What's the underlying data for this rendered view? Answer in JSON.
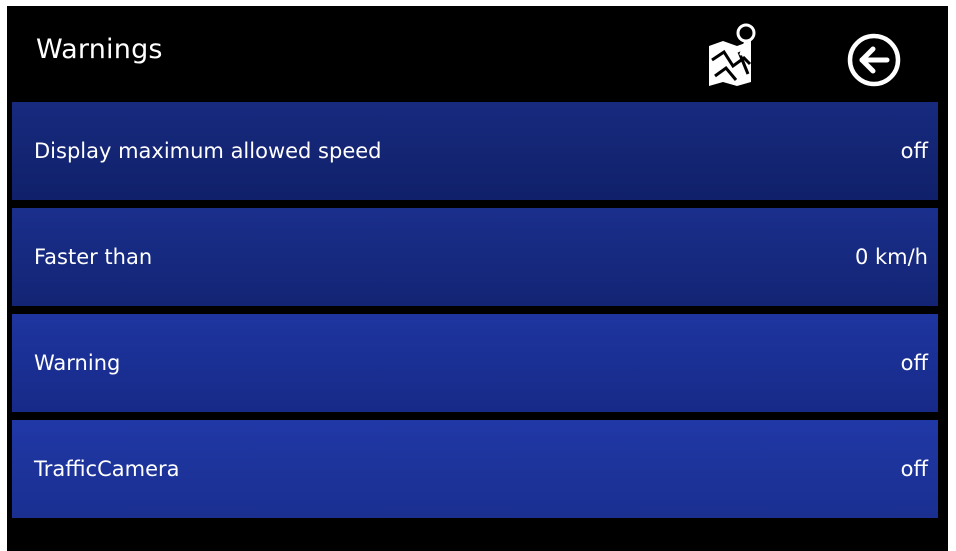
{
  "header": {
    "title": "Warnings",
    "map_icon": "map-pin-icon",
    "back_icon": "back-arrow-icon"
  },
  "settings": {
    "items": [
      {
        "label": "Display maximum allowed speed",
        "value": "off"
      },
      {
        "label": "Faster than",
        "value": "0 km/h"
      },
      {
        "label": "Warning",
        "value": "off"
      },
      {
        "label": "TrafficCamera",
        "value": "off"
      }
    ]
  },
  "colors": {
    "background": "#000000",
    "row_blue": "#1a2f8c",
    "text": "#ffffff"
  }
}
